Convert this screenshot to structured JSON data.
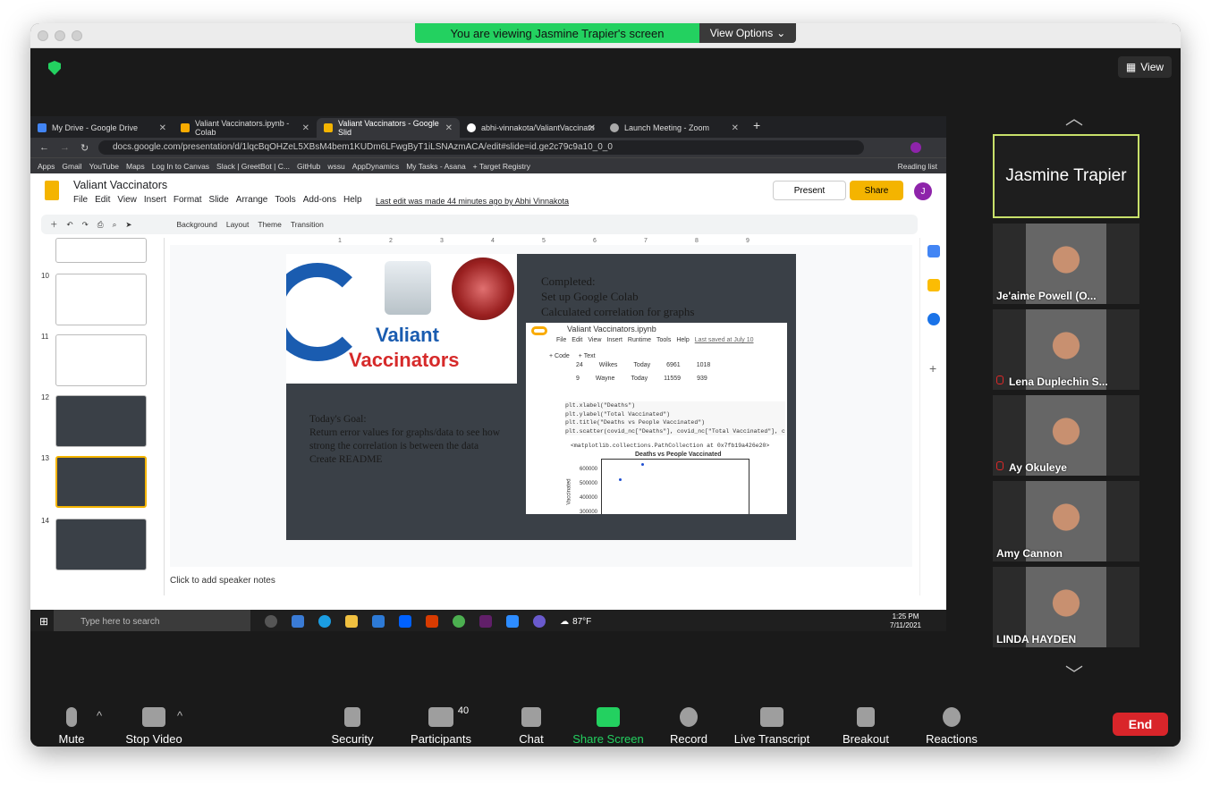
{
  "banner": {
    "viewing_text": "You are viewing Jasmine Trapier's screen",
    "view_options": "View Options"
  },
  "top_right": {
    "view_label": "View"
  },
  "browser": {
    "tabs": [
      {
        "label": "My Drive - Google Drive",
        "color": "#4285f4"
      },
      {
        "label": "Valiant Vaccinators.ipynb - Colab",
        "color": "#f9ab00"
      },
      {
        "label": "Valiant Vaccinators - Google Slid",
        "color": "#f4b400"
      },
      {
        "label": "abhi-vinnakota/ValiantVaccinato",
        "color": "#ffffff"
      },
      {
        "label": "Launch Meeting - Zoom",
        "color": "#aaaaaa"
      }
    ],
    "url": "docs.google.com/presentation/d/1lqcBqOHZeL5XBsM4bem1KUDm6LFwgByT1iLSNAzmACA/edit#slide=id.ge2c79c9a10_0_0",
    "bookmarks": [
      "Apps",
      "Gmail",
      "YouTube",
      "Maps",
      "Log In to Canvas",
      "Slack | GreetBot | C...",
      "GitHub",
      "wssu",
      "AppDynamics",
      "My Tasks - Asana",
      "+ Target Registry"
    ],
    "reading_list": "Reading list"
  },
  "slides_app": {
    "title": "Valiant Vaccinators",
    "menu": [
      "File",
      "Edit",
      "View",
      "Insert",
      "Format",
      "Slide",
      "Arrange",
      "Tools",
      "Add-ons",
      "Help"
    ],
    "last_edit": "Last edit was made 44 minutes ago by Abhi Vinnakota",
    "present": "Present",
    "share": "Share",
    "avatar": "J",
    "toolbar": [
      "Background",
      "Layout",
      "Theme",
      "Transition"
    ],
    "ruler": [
      "1",
      "2",
      "3",
      "4",
      "5",
      "6",
      "7",
      "8",
      "9"
    ],
    "thumb_numbers": [
      "10",
      "11",
      "12",
      "13",
      "14"
    ],
    "speaker_notes": "Click to add speaker notes"
  },
  "slide": {
    "title_line1": "Valiant",
    "title_line2": "Vaccinators",
    "completed_heading": "Completed:",
    "completed_1": "Set up Google Colab",
    "completed_2": "Calculated correlation for graphs",
    "goal_heading": "Today's Goal:",
    "goal_1": "Return error values for graphs/data to see how strong the correlation is between the data",
    "goal_2": "Create README",
    "colab": {
      "filename": "Valiant Vaccinators.ipynb",
      "menu": [
        "File",
        "Edit",
        "View",
        "Insert",
        "Runtime",
        "Tools",
        "Help"
      ],
      "saved": "Last saved at July 10",
      "code_btn": "+ Code",
      "text_btn": "+ Text",
      "row1": [
        "24",
        "Wilkes",
        "Today",
        "6961",
        "1018"
      ],
      "row2": [
        "9",
        "Wayne",
        "Today",
        "11559",
        "939"
      ],
      "code": [
        "plt.xlabel(\"Deaths\")",
        "plt.ylabel(\"Total Vaccinated\")",
        "plt.title(\"Deaths vs People Vaccinated\")",
        "plt.scatter(covid_nc[\"Deaths\"], covid_nc[\"Total Vaccinated\"], c"
      ],
      "output": "<matplotlib.collections.PathCollection at 0x7fb19a426e20>",
      "plot_title": "Deaths vs People Vaccinated",
      "yticks": [
        "600000",
        "500000",
        "400000",
        "300000"
      ],
      "ylabel": "Vaccinated"
    }
  },
  "taskbar": {
    "search": "Type here to search",
    "weather": "87°F",
    "time": "1:25 PM",
    "date": "7/11/2021",
    "badge": "25"
  },
  "participants": [
    {
      "name": "Jasmine Trapier",
      "active": true
    },
    {
      "name": "Je'aime Powell (O...",
      "muted": false
    },
    {
      "name": "Lena Duplechin S...",
      "muted": true
    },
    {
      "name": "Ay Okuleye",
      "muted": true
    },
    {
      "name": "Amy Cannon",
      "muted": false
    },
    {
      "name": "LINDA HAYDEN",
      "muted": false
    }
  ],
  "controls": {
    "mute": "Mute",
    "stop_video": "Stop Video",
    "security": "Security",
    "participants": "Participants",
    "participant_count": "40",
    "chat": "Chat",
    "share_screen": "Share Screen",
    "record": "Record",
    "live_transcript": "Live Transcript",
    "breakout_rooms": "Breakout Rooms",
    "reactions": "Reactions",
    "end": "End"
  }
}
